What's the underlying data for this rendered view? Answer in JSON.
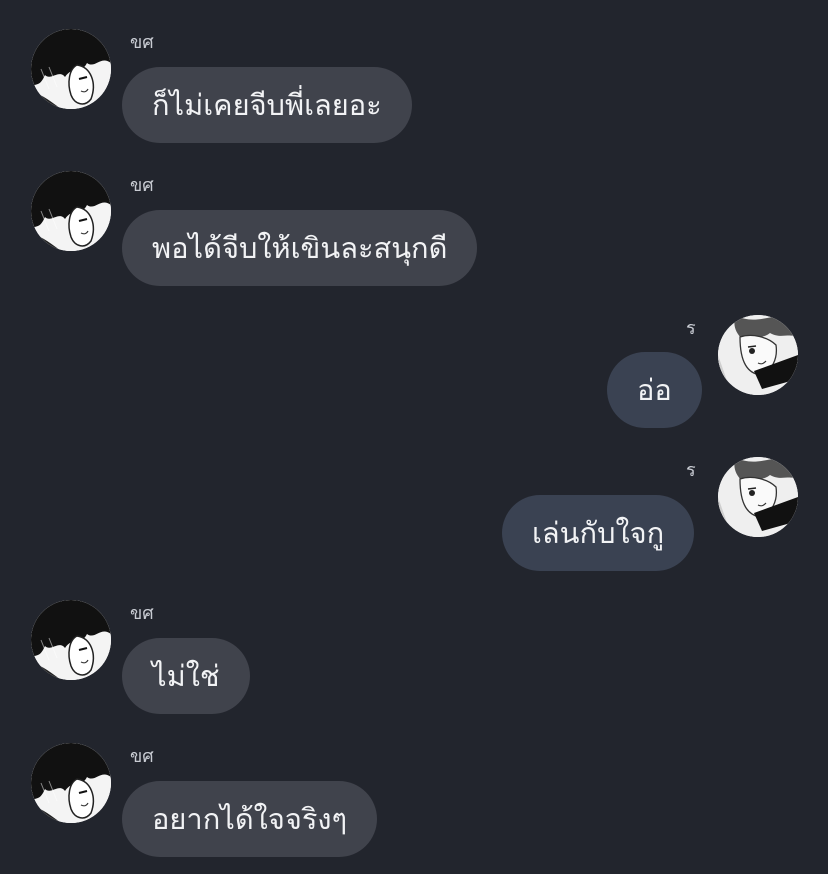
{
  "colors": {
    "background": "#22252d",
    "incoming_bubble": "#40434c",
    "outgoing_bubble": "#3a4252",
    "text": "#f2f3f5",
    "sender_text": "#c9ccd3"
  },
  "messages": [
    {
      "direction": "incoming",
      "sender": "ขศ",
      "text": "ก็ไม่เคยจีบพี่เลยอะ",
      "avatar_icon": "dark-haired-character-avatar-icon"
    },
    {
      "direction": "incoming",
      "sender": "ขศ",
      "text": "พอได้จีบให้เขินละสนุกดี",
      "avatar_icon": "dark-haired-character-avatar-icon"
    },
    {
      "direction": "outgoing",
      "sender": "ร",
      "text": "อ่อ",
      "avatar_icon": "manga-character-avatar-icon"
    },
    {
      "direction": "outgoing",
      "sender": "ร",
      "text": "เล่นกับใจกู",
      "avatar_icon": "manga-character-avatar-icon"
    },
    {
      "direction": "incoming",
      "sender": "ขศ",
      "text": "ไม่ใช่",
      "avatar_icon": "dark-haired-character-avatar-icon"
    },
    {
      "direction": "incoming",
      "sender": "ขศ",
      "text": "อยากได้ใจจริงๆ",
      "avatar_icon": "dark-haired-character-avatar-icon"
    }
  ]
}
